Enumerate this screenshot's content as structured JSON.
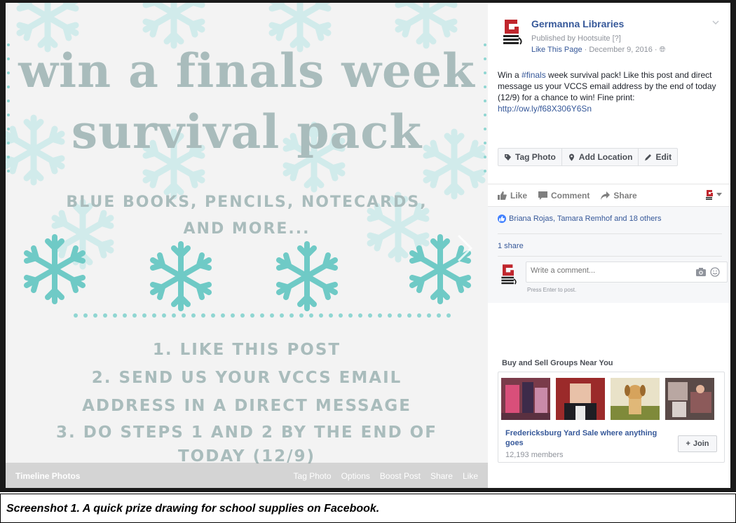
{
  "photo": {
    "headline_1": "win a finals week",
    "headline_2": "survival pack",
    "subtitle_1": "BLUE BOOKS, PENCILS, NOTECARDS,",
    "subtitle_2": "AND MORE...",
    "steps": [
      "1. LIKE THIS POST",
      "2. SEND US YOUR VCCS EMAIL",
      "ADDRESS IN A DIRECT MESSAGE",
      "3. DO STEPS 1 AND 2 BY THE END OF",
      "TODAY (12/9)"
    ],
    "bar": {
      "album": "Timeline Photos",
      "actions": [
        "Tag Photo",
        "Options",
        "Boost Post",
        "Share",
        "Like"
      ]
    },
    "colors": {
      "text": "#a9bcbc",
      "snowflake_light": "#bfe6e6",
      "snowflake_dark": "#5cc6c2",
      "dots": "#8fd6d2"
    }
  },
  "post": {
    "page_name": "Germanna Libraries",
    "published_by": "Published by Hootsuite",
    "published_q": "[?]",
    "like_page": "Like This Page",
    "date": "· December 9, 2016 ·",
    "text_before_tag": "Win a ",
    "tag": "#finals",
    "text_after_tag": " week survival pack! Like this post and direct message us your VCCS email address by the end of today (12/9) for a chance to win! Fine print: ",
    "link": "http://ow.ly/f68X306Y6Sn",
    "photo_actions": [
      "Tag Photo",
      "Add Location",
      "Edit"
    ],
    "actions": {
      "like": "Like",
      "comment": "Comment",
      "share": "Share"
    },
    "likers": "Briana Rojas, Tamara Remhof and 18 others",
    "shares": "1 share",
    "comment_placeholder": "Write a comment...",
    "press_enter": "Press Enter to post."
  },
  "groups": {
    "title": "Buy and Sell Groups Near You",
    "name": "Fredericksburg Yard Sale where anything goes",
    "members": "12,193 members",
    "join": "Join"
  },
  "caption": "Screenshot 1. A quick prize drawing for school supplies on Facebook."
}
